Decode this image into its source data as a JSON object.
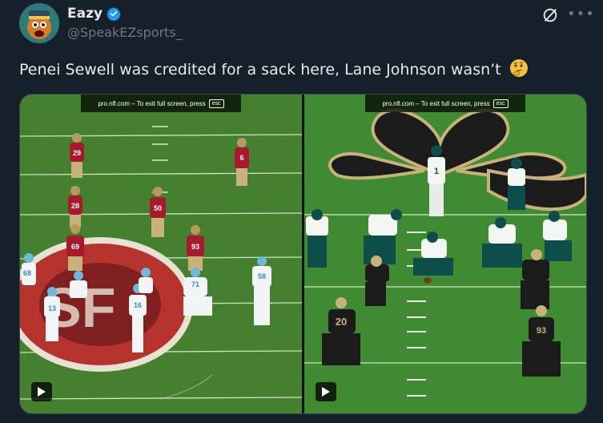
{
  "post": {
    "display_name": "Eazy",
    "handle": "@SpeakEZsports_",
    "text": "Penei Sewell was credited for a sack here, Lane Johnson wasn’t",
    "emoji": "thinking-face",
    "more_label": "•••"
  },
  "media": {
    "left_overlay": "pro.nfl.com – To exit full screen, press",
    "right_overlay": "pro.nfl.com – To exit full screen, press",
    "esc_label": "esc",
    "left_jerseys": [
      "29",
      "6",
      "28",
      "50",
      "93",
      "69",
      "68",
      "13",
      "16",
      "71",
      "58"
    ],
    "right_jerseys": [
      "1",
      "20",
      "93"
    ]
  },
  "colors": {
    "background": "#15202b",
    "text": "#e7e9ea",
    "muted": "#71767b",
    "verified": "#1d9bf0",
    "field_green": "#3f7f2f",
    "niners_red": "#a8192e",
    "lions_blue": "#6fb8d9",
    "saints_black": "#1b1b1b",
    "saints_gold": "#c8b27a"
  }
}
